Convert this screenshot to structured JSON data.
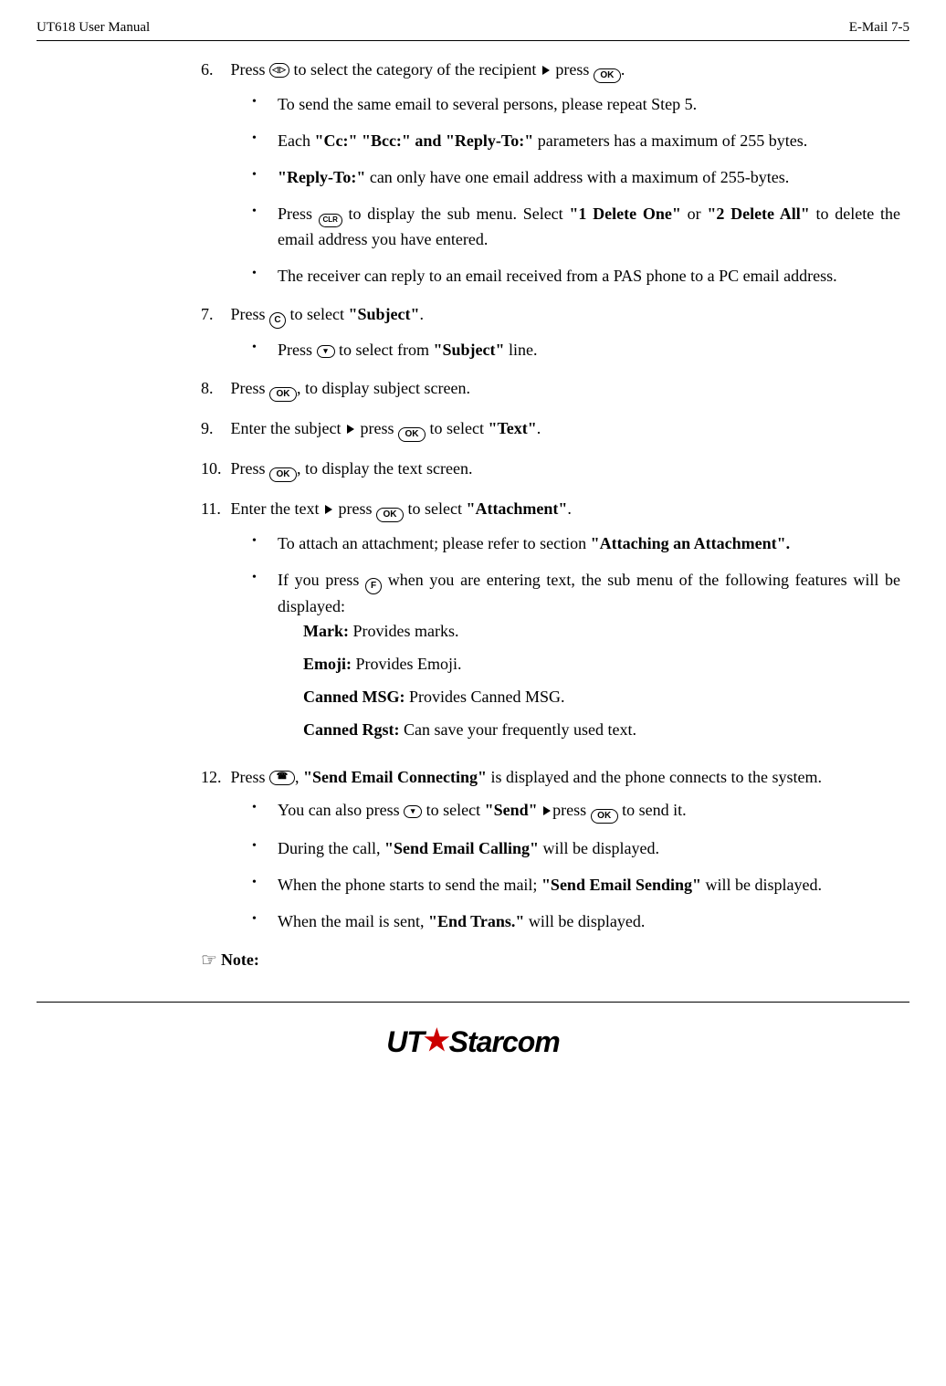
{
  "header": {
    "left": "UT618 User Manual",
    "right": "E-Mail   7-5"
  },
  "steps": {
    "s6": {
      "num": "6.",
      "pre": "Press ",
      "mid": " to select the category of the recipient ",
      "post": "press ",
      "end": "."
    },
    "s6b1": "To send the same email to several persons, please repeat Step 5.",
    "s6b2": {
      "pre": "Each ",
      "bold": "\"Cc:\" \"Bcc:\" and \"Reply-To:\"",
      "post": " parameters has a maximum of 255 bytes."
    },
    "s6b3": {
      "bold": "\"Reply-To:\"",
      "post": " can only have one email address with a maximum of 255-bytes."
    },
    "s6b4": {
      "pre": "Press ",
      "mid": " to display the sub menu. Select ",
      "b1": "\"1 Delete One\"",
      "or": " or ",
      "b2": "\"2 Delete All\"",
      "post": " to delete the email address you have entered."
    },
    "s6b5": "The receiver can reply to an email received from a PAS phone to a PC email address.",
    "s7": {
      "num": "7.",
      "pre": "Press ",
      "mid": " to select ",
      "bold": "\"Subject\"",
      "end": "."
    },
    "s7b1": {
      "pre": "Press ",
      "mid": " to select from ",
      "bold": "\"Subject\"",
      "post": " line."
    },
    "s8": {
      "num": "8.",
      "pre": "Press ",
      "post": ", to display subject screen."
    },
    "s9": {
      "num": "9.",
      "pre": "Enter the subject ",
      "mid": "press ",
      "post": " to select ",
      "bold": "\"Text\"",
      "end": "."
    },
    "s10": {
      "num": "10.",
      "pre": "Press ",
      "post": ", to display the text screen."
    },
    "s11": {
      "num": "11.",
      "pre": "Enter the text ",
      "mid": "press ",
      "post": " to select ",
      "bold": "\"Attachment\"",
      "end": "."
    },
    "s11b1": {
      "pre": "To attach an attachment; please refer to section ",
      "bold": "\"Attaching an Attachment\"."
    },
    "s11b2": {
      "pre": "If you press ",
      "post": " when you are entering text, the sub menu of the following features will be displayed:"
    },
    "feat": {
      "mark": {
        "label": "Mark:",
        "desc": " Provides marks."
      },
      "emoji": {
        "label": "Emoji:",
        "desc": " Provides Emoji."
      },
      "canned": {
        "label": "Canned MSG:",
        "desc": " Provides Canned MSG."
      },
      "rgst": {
        "label": "Canned Rgst:",
        "desc": " Can save your frequently used text."
      }
    },
    "s12": {
      "num": "12.",
      "pre": "Press ",
      "mid": ", ",
      "bold": "\"Send Email Connecting\"",
      "post": " is displayed and the phone connects to the system."
    },
    "s12b1": {
      "pre": "You can also press ",
      "mid": " to select ",
      "bold": "\"Send\"",
      "mid2": " ",
      "mid3": "press ",
      "post": " to send it."
    },
    "s12b2": {
      "pre": "During the call, ",
      "bold": "\"Send Email Calling\"",
      "post": " will be displayed."
    },
    "s12b3": {
      "pre": "When the phone starts to send the mail; ",
      "bold": "\"Send Email Sending\"",
      "post": " will be displayed."
    },
    "s12b4": {
      "pre": "When the mail is sent, ",
      "bold": "\"End Trans.\"",
      "post": " will be displayed."
    }
  },
  "note_label": "Note:",
  "icons": {
    "ok": "OK",
    "clr": "CLR",
    "c": "C",
    "f": "F"
  },
  "logo": {
    "ut": "UT",
    "rest": "Starcom"
  }
}
